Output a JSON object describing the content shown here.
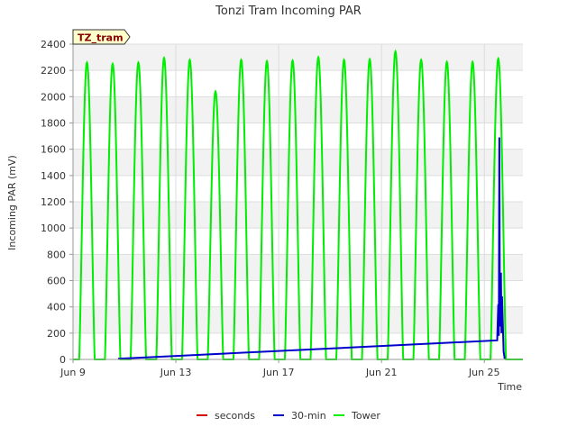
{
  "chart_data": {
    "type": "line",
    "title": "Tonzi Tram Incoming PAR",
    "xlabel": "Time",
    "ylabel": "Incoming PAR (mV)",
    "site_badge": "TZ_tram",
    "xlim": [
      "2024-06-09T00:00",
      "2024-06-26T12:00"
    ],
    "ylim": [
      0,
      2400
    ],
    "yticks": [
      0,
      200,
      400,
      600,
      800,
      1000,
      1200,
      1400,
      1600,
      1800,
      2000,
      2200,
      2400
    ],
    "xticks": [
      {
        "label": "Jun 9",
        "date": "2024-06-09T00:00"
      },
      {
        "label": "Jun 13",
        "date": "2024-06-13T00:00"
      },
      {
        "label": "Jun 17",
        "date": "2024-06-17T00:00"
      },
      {
        "label": "Jun 21",
        "date": "2024-06-21T00:00"
      },
      {
        "label": "Jun 25",
        "date": "2024-06-25T00:00"
      }
    ],
    "grid": true,
    "legend_position": "bottom",
    "series": [
      {
        "name": "seconds",
        "color": "#cc0000",
        "points": []
      },
      {
        "name": "30-min",
        "color": "#0000cc",
        "points": [
          {
            "x": "2024-06-10T18:00",
            "y": 5
          },
          {
            "x": "2024-06-25T12:00",
            "y": 145
          },
          {
            "x": "2024-06-25T13:00",
            "y": 420
          },
          {
            "x": "2024-06-25T13:30",
            "y": 180
          },
          {
            "x": "2024-06-25T14:00",
            "y": 1690
          },
          {
            "x": "2024-06-25T14:30",
            "y": 250
          },
          {
            "x": "2024-06-25T15:30",
            "y": 660
          },
          {
            "x": "2024-06-25T16:00",
            "y": 200
          },
          {
            "x": "2024-06-25T16:30",
            "y": 480
          },
          {
            "x": "2024-06-25T18:00",
            "y": 60
          },
          {
            "x": "2024-06-25T19:00",
            "y": 5
          }
        ]
      },
      {
        "name": "Tower",
        "color": "#00ee00",
        "daily_peaks": [
          {
            "x": "2024-06-09T13:00",
            "y": 2260
          },
          {
            "x": "2024-06-10T13:00",
            "y": 2250
          },
          {
            "x": "2024-06-11T13:00",
            "y": 2260
          },
          {
            "x": "2024-06-12T13:00",
            "y": 2295
          },
          {
            "x": "2024-06-13T13:00",
            "y": 2280
          },
          {
            "x": "2024-06-14T13:00",
            "y": 2040
          },
          {
            "x": "2024-06-15T13:00",
            "y": 2280
          },
          {
            "x": "2024-06-16T13:00",
            "y": 2270
          },
          {
            "x": "2024-06-17T13:00",
            "y": 2275
          },
          {
            "x": "2024-06-18T13:00",
            "y": 2300
          },
          {
            "x": "2024-06-19T13:00",
            "y": 2280
          },
          {
            "x": "2024-06-20T13:00",
            "y": 2285
          },
          {
            "x": "2024-06-21T13:00",
            "y": 2345
          },
          {
            "x": "2024-06-22T13:00",
            "y": 2280
          },
          {
            "x": "2024-06-23T13:00",
            "y": 2265
          },
          {
            "x": "2024-06-24T13:00",
            "y": 2265
          },
          {
            "x": "2024-06-25T13:00",
            "y": 2290
          }
        ]
      }
    ]
  }
}
